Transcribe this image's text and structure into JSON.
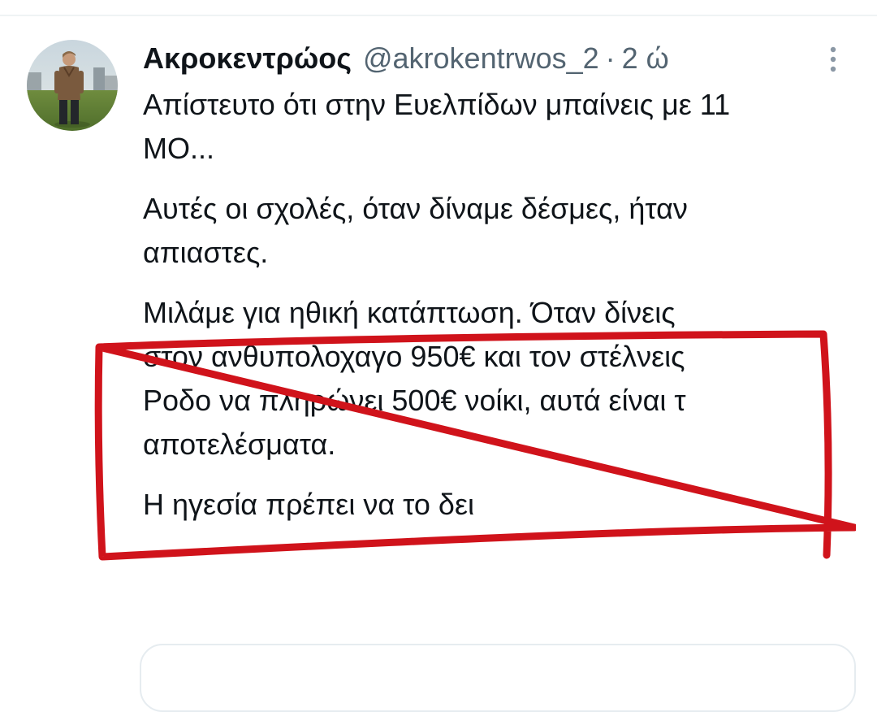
{
  "tweet": {
    "display_name": "Ακροκεντρώος",
    "handle": "@akrokentrwos_2",
    "separator": "·",
    "time": "2 ώ",
    "paragraphs": [
      [
        "Απίστευτο ότι στην Ευελπίδων μπαίνεις με 11",
        "ΜΟ..."
      ],
      [
        "Αυτές οι σχολές, όταν δίναμε δέσμες, ήταν",
        "απιαστες."
      ],
      [
        "Μιλάμε για ηθική κατάπτωση. Όταν δίνεις",
        "στον ανθυπολοχαγο 950€ και τον στέλνεις",
        "Ροδο να πληρώνει 500€ νοίκι, αυτά είναι τ",
        "αποτελέσματα."
      ],
      [
        "Η ηγεσία πρέπει να το δει"
      ]
    ]
  },
  "icons": {
    "avatar": "profile-photo",
    "more": "more-vertical-icon"
  },
  "colors": {
    "text_primary": "#0f1419",
    "text_secondary": "#536471",
    "annotation_red": "#d0131b",
    "divider": "#eff3f4"
  }
}
